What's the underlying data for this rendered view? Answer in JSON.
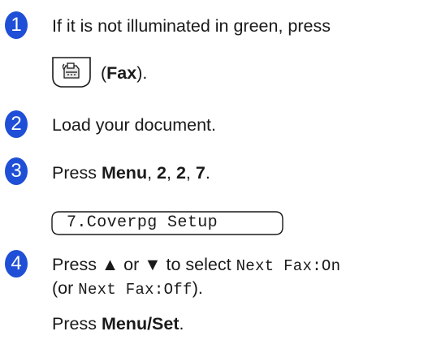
{
  "steps": [
    {
      "number": "1",
      "text_a": "If it is not illuminated in green, press",
      "key_label_open": "(",
      "key_label": "Fax",
      "key_label_close": ")."
    },
    {
      "number": "2",
      "text": "Load your document."
    },
    {
      "number": "3",
      "press": "Press ",
      "menu": "Menu",
      "sep1": ", ",
      "k1": "2",
      "sep2": ", ",
      "k2": "2",
      "sep3": ", ",
      "k3": "7",
      "end": ".",
      "lcd_text": "7.Coverpg Setup"
    },
    {
      "number": "4",
      "line1_a": "Press ▲ or ▼ to select ",
      "line1_code": "Next Fax:On",
      "line2_a": "(or ",
      "line2_code": "Next Fax:Off",
      "line2_b": ").",
      "line3_a": "Press ",
      "line3_key": "Menu/Set",
      "line3_b": "."
    }
  ],
  "icons": {
    "step_badge": "step-number-circle-icon",
    "fax_key": "fax-key-icon",
    "lcd": "lcd-display-icon"
  },
  "colors": {
    "badge": "#1f4fd6",
    "text": "#1a1a1a"
  }
}
